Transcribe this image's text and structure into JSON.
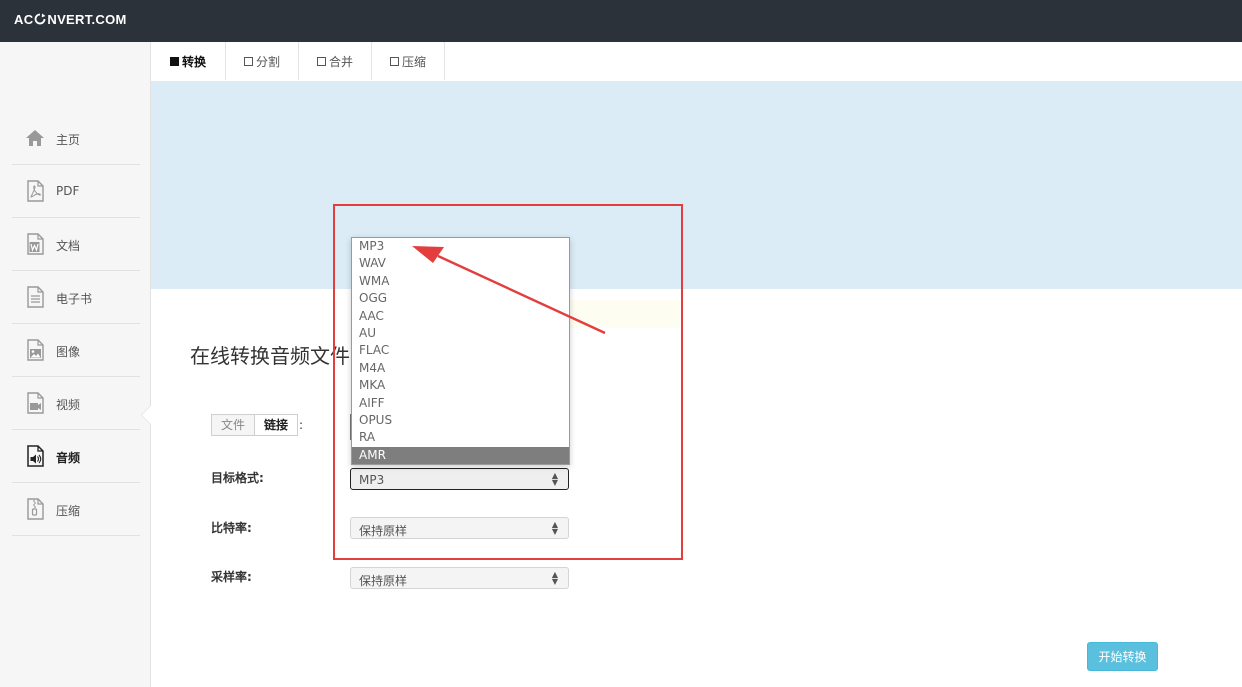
{
  "header": {
    "logo_prefix": "AC",
    "logo_suffix": "NVERT.COM"
  },
  "sidebar": {
    "items": [
      {
        "label": "主页",
        "icon": "home-icon"
      },
      {
        "label": "PDF",
        "icon": "pdf-file-icon"
      },
      {
        "label": "文档",
        "icon": "word-document-icon"
      },
      {
        "label": "电子书",
        "icon": "ebook-icon"
      },
      {
        "label": "图像",
        "icon": "image-file-icon"
      },
      {
        "label": "视频",
        "icon": "video-file-icon"
      },
      {
        "label": "音频",
        "icon": "audio-file-icon",
        "active": true
      },
      {
        "label": "压缩",
        "icon": "zip-file-icon"
      }
    ]
  },
  "tabs": [
    {
      "label": "转换",
      "active": true
    },
    {
      "label": "分割"
    },
    {
      "label": "合并"
    },
    {
      "label": "压缩"
    }
  ],
  "main": {
    "title": "在线转换音频文件",
    "source_toggle": {
      "file": "文件",
      "link": "链接",
      "colon": ":"
    },
    "target_format": {
      "label": "目标格式:",
      "value": "MP3"
    },
    "bitrate": {
      "label": "比特率:",
      "value": "保持原样"
    },
    "sample_rate": {
      "label": "采样率:",
      "value": "保持原样"
    },
    "start_button": "开始转换"
  },
  "format_dropdown": {
    "options": [
      "MP3",
      "WAV",
      "WMA",
      "OGG",
      "AAC",
      "AU",
      "FLAC",
      "M4A",
      "MKA",
      "AIFF",
      "OPUS",
      "RA",
      "AMR"
    ],
    "highlighted": "AMR",
    "selected": "MP3"
  },
  "colors": {
    "topbar": "#2b323a",
    "banner": "#dcecf6",
    "annotation_red": "#e43d3d",
    "button": "#5bc0de",
    "dropdown_highlight": "#7e7e7e"
  }
}
